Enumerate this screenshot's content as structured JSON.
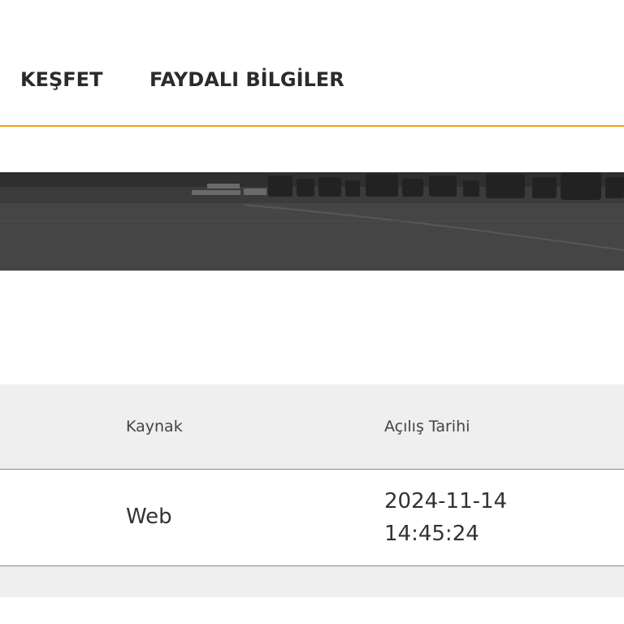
{
  "nav": {
    "items": [
      {
        "label": "KEŞFET"
      },
      {
        "label": "FAYDALI BİLGİLER"
      }
    ],
    "accent_color": "#f0a30a"
  },
  "table": {
    "headers": [
      "Kaynak",
      "Açılış Tarihi"
    ],
    "rows": [
      {
        "kaynak": "Web",
        "date": "2024-11-14",
        "time": "14:45:24"
      }
    ]
  }
}
